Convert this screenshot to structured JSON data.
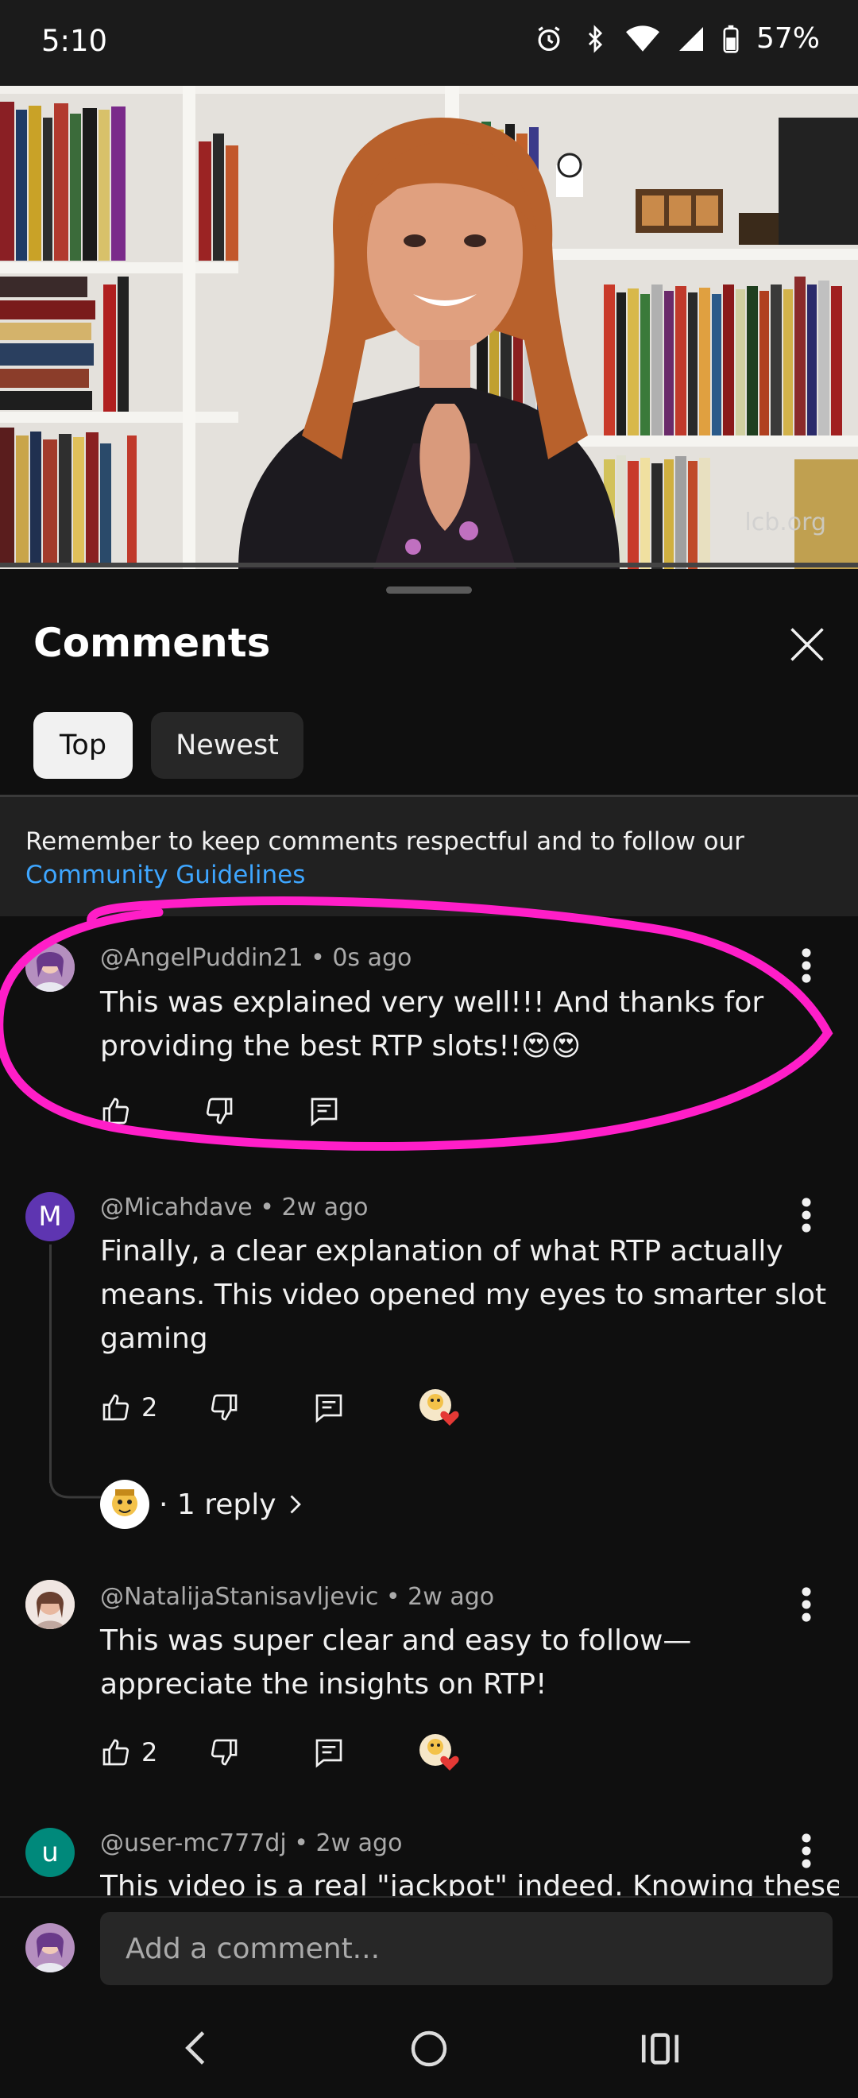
{
  "status": {
    "time": "5:10",
    "battery": "57%"
  },
  "video": {
    "watermark": "lcb.org"
  },
  "sheet": {
    "title": "Comments",
    "tabs": [
      {
        "label": "Top",
        "selected": true
      },
      {
        "label": "Newest",
        "selected": false
      }
    ],
    "notice_text": "Remember to keep comments respectful and to follow our ",
    "notice_link": "Community Guidelines"
  },
  "comments": [
    {
      "author": "@AngelPuddin21",
      "time": "0s ago",
      "text": "This was explained very well!!! And thanks for providing the best RTP slots!!😍😍",
      "likes": "",
      "avatar_color": "#c7a1c9"
    },
    {
      "author": "@Micahdave",
      "time": "2w ago",
      "text": "Finally, a clear explanation of what RTP actually means. This video opened my eyes to smarter slot gaming",
      "likes": "2",
      "avatar_letter": "M",
      "avatar_color": "#5e35b1",
      "reply_label": "· 1 reply"
    },
    {
      "author": "@NatalijaStanisavljevic",
      "time": "2w ago",
      "text": "This was super clear and easy to follow—appreciate the insights on RTP!",
      "likes": "2",
      "avatar_color": "#d9b8a8"
    },
    {
      "author": "@user-mc777dj",
      "time": "2w ago",
      "text": "This video is a real \"jackpot\" indeed. Knowing these",
      "avatar_letter": "u",
      "avatar_color": "#00897b"
    }
  ],
  "composer": {
    "placeholder": "Add a comment..."
  },
  "colors": {
    "annotation": "#ff1ec8",
    "link": "#3ea6ff",
    "heart": "#e53935"
  }
}
